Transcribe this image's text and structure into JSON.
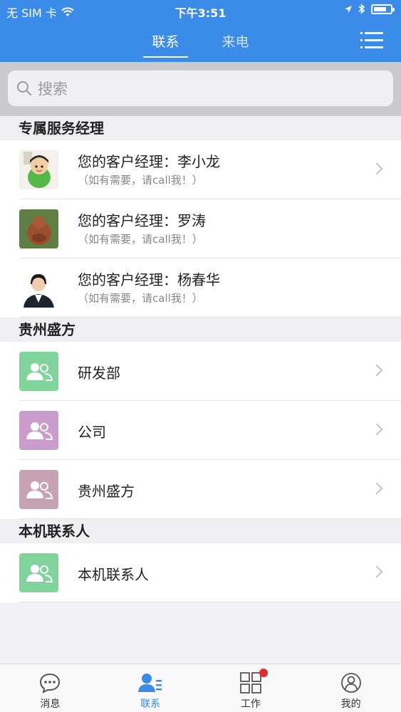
{
  "status_bar": {
    "carrier": "无 SIM 卡",
    "time": "下午3:51",
    "battery_level": 0.75
  },
  "header": {
    "tabs": [
      {
        "label": "联系",
        "active": true
      },
      {
        "label": "来电",
        "active": false
      }
    ],
    "menu_icon": "menu-list-icon"
  },
  "search": {
    "placeholder": "搜索"
  },
  "sections": {
    "managers": {
      "title": "专属服务经理",
      "items": [
        {
          "title": "您的客户经理：李小龙",
          "subtitle": "（如有需要，请call我！）"
        },
        {
          "title": "您的客户经理：罗涛",
          "subtitle": "（如有需要，请call我！）"
        },
        {
          "title": "您的客户经理：杨春华",
          "subtitle": "（如有需要，请call我！）"
        }
      ]
    },
    "company": {
      "title": "贵州盛方",
      "items": [
        {
          "label": "研发部",
          "color": "#7fd39b"
        },
        {
          "label": "公司",
          "color": "#cc9ccd"
        },
        {
          "label": "贵州盛方",
          "color": "#c7a3b2"
        }
      ]
    },
    "local": {
      "title": "本机联系人",
      "items": [
        {
          "label": "本机联系人",
          "color": "#7fd39b"
        }
      ]
    }
  },
  "bottom_nav": [
    {
      "label": "消息",
      "icon": "message-icon",
      "active": false
    },
    {
      "label": "联系",
      "icon": "contacts-icon",
      "active": true
    },
    {
      "label": "工作",
      "icon": "grid-icon",
      "active": false,
      "badge": true
    },
    {
      "label": "我的",
      "icon": "profile-icon",
      "active": false
    }
  ],
  "colors": {
    "accent": "#3b8be8",
    "badge": "#e52a2a"
  }
}
